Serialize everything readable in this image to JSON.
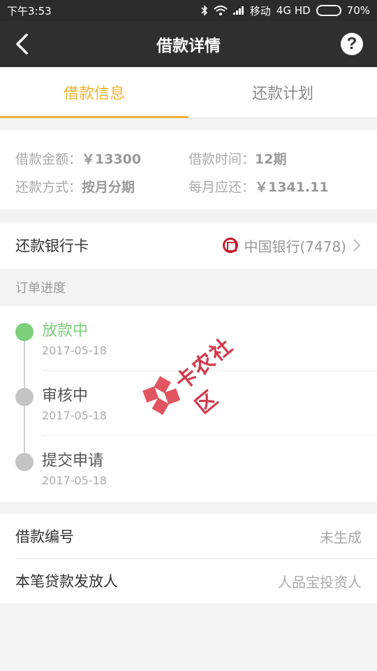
{
  "status_bar": {
    "time": "下午3:53",
    "carrier": "移动",
    "network": "4G HD",
    "battery": "70%",
    "battery_level": 0.7
  },
  "nav": {
    "title": "借款详情",
    "back_icon": "chevron-left-icon",
    "help_icon": "question-icon",
    "help_glyph": "?"
  },
  "tabs": [
    {
      "label": "借款信息",
      "active": true
    },
    {
      "label": "还款计划",
      "active": false
    }
  ],
  "loan_info": {
    "amount_label": "借款金额：",
    "amount_value": "￥13300",
    "term_label": "借款时间：",
    "term_value": "12期",
    "method_label": "还款方式：",
    "method_value": "按月分期",
    "monthly_label": "每月应还：",
    "monthly_value": "￥1341.11"
  },
  "bank": {
    "label": "还款银行卡",
    "value": "中国银行(7478)",
    "icon": "bank-of-china-icon"
  },
  "progress": {
    "title": "订单进度",
    "steps": [
      {
        "name": "放款中",
        "date": "2017-05-18",
        "active": true
      },
      {
        "name": "审核中",
        "date": "2017-05-18",
        "active": false
      },
      {
        "name": "提交申请",
        "date": "2017-05-18",
        "active": false
      }
    ]
  },
  "watermark": {
    "text": "卡农社区"
  },
  "details": [
    {
      "label": "借款编号",
      "value": "未生成"
    },
    {
      "label": "本笔贷款发放人",
      "value": "人品宝投资人"
    }
  ],
  "colors": {
    "accent": "#f0b433",
    "active_green": "#7dcf7b",
    "bank_red": "#c8192e",
    "header_bg": "#2f2f2f"
  }
}
